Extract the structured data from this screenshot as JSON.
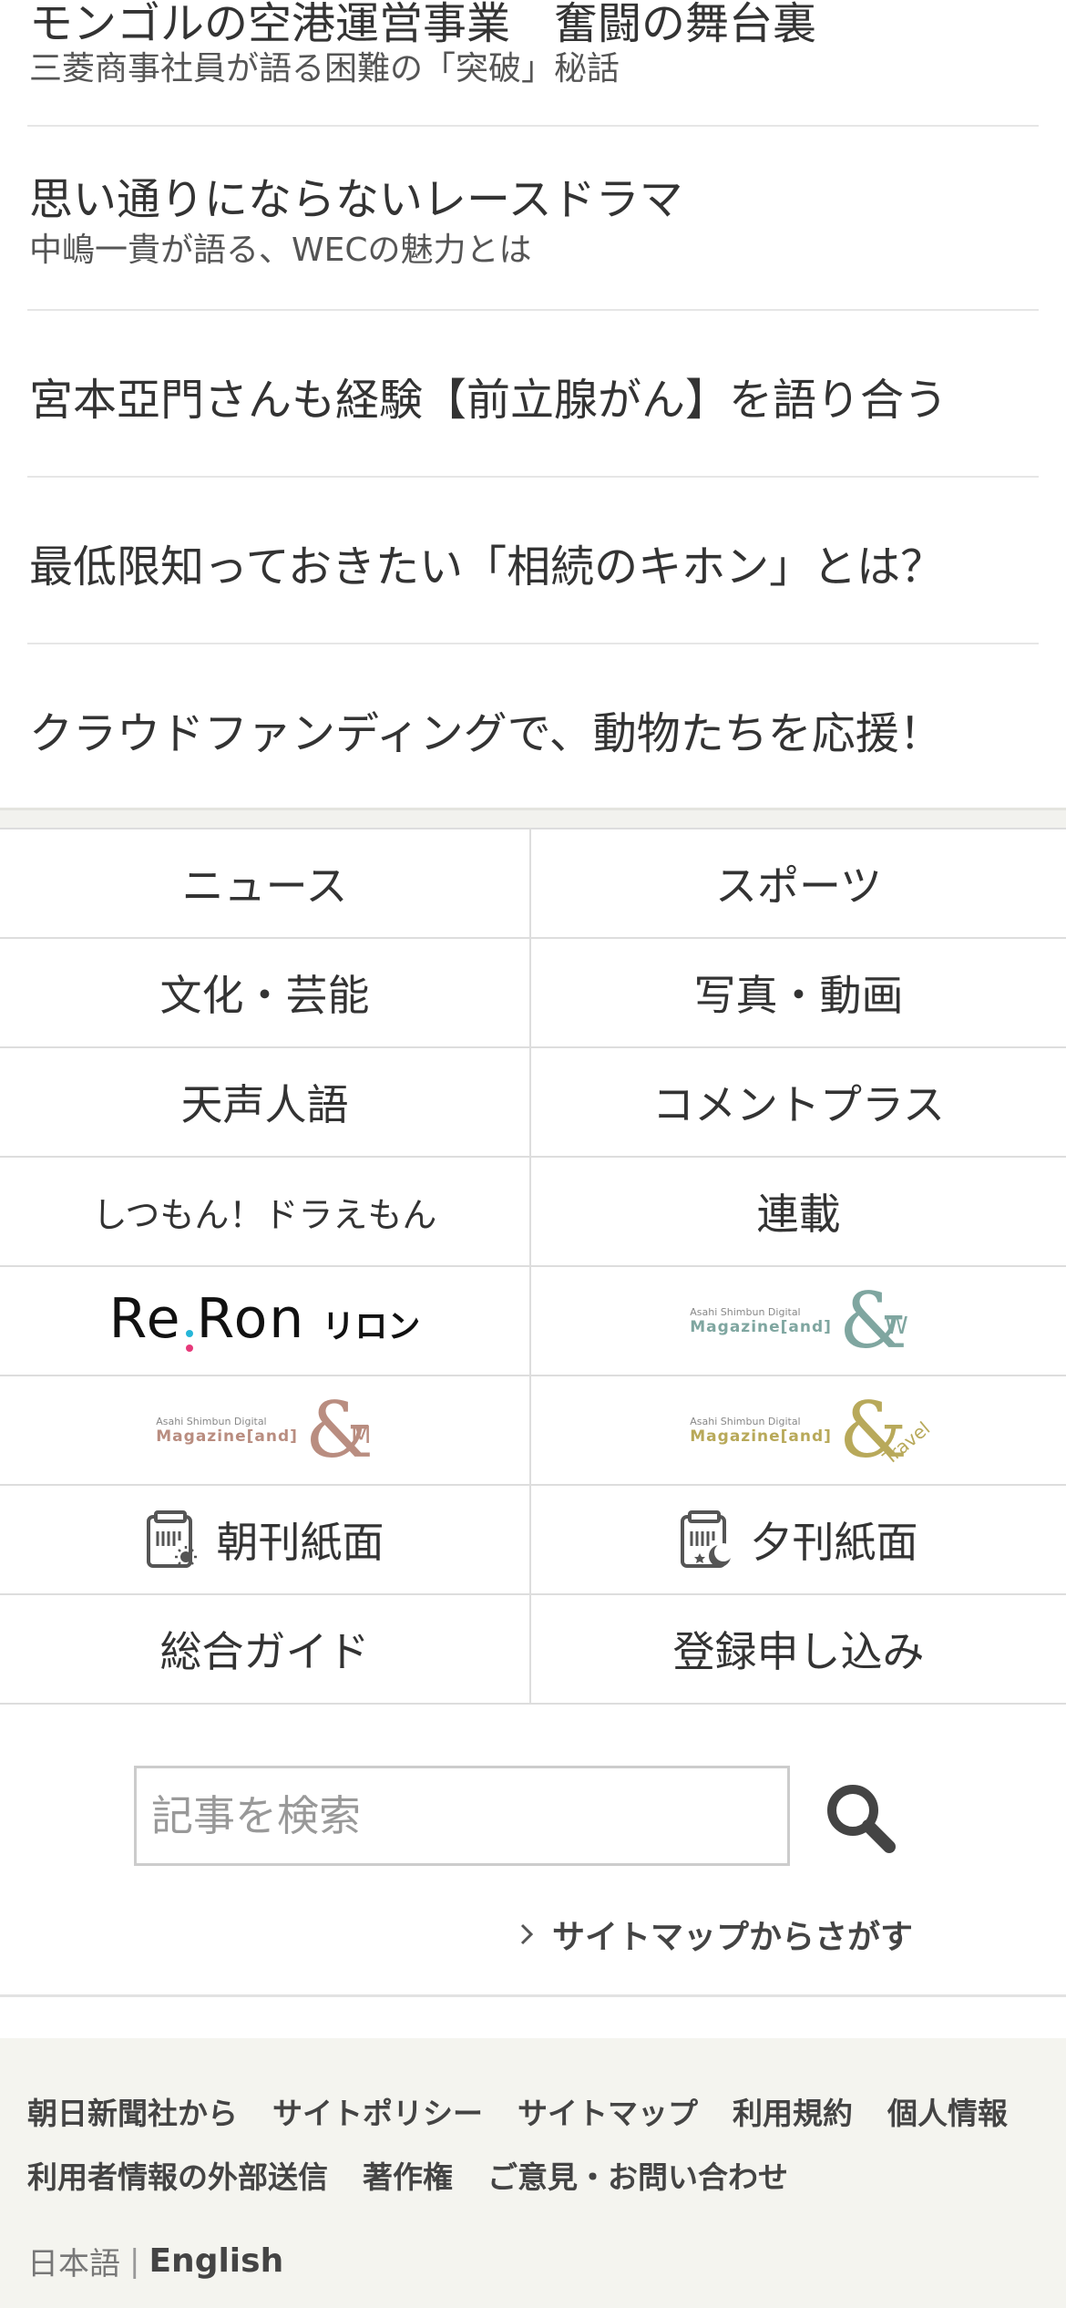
{
  "articles": [
    {
      "title": "モンゴルの空港運営事業　奮闘の舞台裏",
      "subtitle": "三菱商事社員が語る困難の「突破」秘話"
    },
    {
      "title": "思い通りにならないレースドラマ",
      "subtitle": "中嶋一貴が語る、WECの魅力とは"
    },
    {
      "title": "宮本亞門さんも経験【前立腺がん】を語り合う"
    },
    {
      "title": "最低限知っておきたい「相続のキホン」とは？"
    },
    {
      "title": "クラウドファンディングで、動物たちを応援！"
    }
  ],
  "nav": {
    "news": "ニュース",
    "sports": "スポーツ",
    "culture": "文化・芸能",
    "photo_video": "写真・動画",
    "tenseijingo": "天声人語",
    "comment_plus": "コメントプラス",
    "doraemon": "しつもん！ドラえもん",
    "serial": "連載",
    "reron_logo": "Re:Ron",
    "reron_kana": "リロン",
    "magazine_w_line1": "Asahi Shimbun Digital",
    "magazine_w_line2": "Magazine[and]",
    "magazine_w_mark": "W",
    "magazine_m_line1": "Asahi Shimbun Digital",
    "magazine_m_line2": "Magazine[and]",
    "magazine_m_mark": "M",
    "magazine_travel_line1": "Asahi Shimbun Digital",
    "magazine_travel_line2": "Magazine[and]",
    "magazine_travel_mark": "Travel",
    "morning_paper": "朝刊紙面",
    "evening_paper": "夕刊紙面",
    "guide": "総合ガイド",
    "register": "登録申し込み"
  },
  "search": {
    "placeholder": "記事を検索",
    "value": ""
  },
  "sitemap_link": "サイトマップからさがす",
  "footer": {
    "row1": [
      "朝日新聞社から",
      "サイトポリシー",
      "サイトマップ",
      "利用規約",
      "個人情報"
    ],
    "row2": [
      "利用者情報の外部送信",
      "著作権",
      "ご意見・お問い合わせ"
    ],
    "lang_ja": "日本語",
    "lang_sep": "|",
    "lang_en": "English"
  },
  "colors": {
    "text": "#333333",
    "border": "#dddddd",
    "footer_bg": "#f4f4ef",
    "magazine_w": "#7fa6a0",
    "magazine_m": "#b98d80",
    "magazine_travel": "#b8a95a",
    "reron_cyan": "#26b6d8",
    "reron_pink": "#e6397a",
    "reron_yellow": "#f4c21a"
  },
  "icons": [
    "search-icon",
    "chevron-right-icon",
    "morning-paper-icon",
    "evening-paper-icon"
  ]
}
